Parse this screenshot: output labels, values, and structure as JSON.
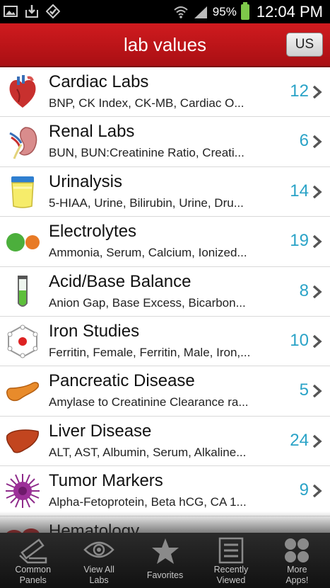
{
  "status_bar": {
    "battery_percent": "95%",
    "time": "12:04 PM",
    "icons": [
      "gallery-icon",
      "download-icon",
      "check-badge-icon",
      "wifi-icon",
      "signal-icon",
      "battery-icon"
    ]
  },
  "header": {
    "title": "lab values",
    "unit_button": "US"
  },
  "list": {
    "items": [
      {
        "title": "Cardiac Labs",
        "subtitle": "BNP, CK Index, CK-MB, Cardiac O...",
        "count": "12",
        "icon": "heart-icon"
      },
      {
        "title": "Renal Labs",
        "subtitle": "BUN, BUN:Creatinine Ratio, Creati...",
        "count": "6",
        "icon": "kidney-icon"
      },
      {
        "title": "Urinalysis",
        "subtitle": "5-HIAA, Urine, Bilirubin, Urine, Dru...",
        "count": "14",
        "icon": "urine-cup-icon"
      },
      {
        "title": "Electrolytes",
        "subtitle": "Ammonia, Serum, Calcium, Ionized...",
        "count": "19",
        "icon": "electrolytes-icon"
      },
      {
        "title": "Acid/Base Balance",
        "subtitle": "Anion Gap, Base Excess, Bicarbon...",
        "count": "8",
        "icon": "test-tube-icon"
      },
      {
        "title": "Iron Studies",
        "subtitle": "Ferritin, Female, Ferritin, Male, Iron,...",
        "count": "10",
        "icon": "molecule-icon"
      },
      {
        "title": "Pancreatic Disease",
        "subtitle": "Amylase to Creatinine Clearance ra...",
        "count": "5",
        "icon": "pancreas-icon"
      },
      {
        "title": "Liver Disease",
        "subtitle": "ALT, AST, Albumin, Serum, Alkaline...",
        "count": "24",
        "icon": "liver-icon"
      },
      {
        "title": "Tumor Markers",
        "subtitle": "Alpha-Fetoprotein, Beta hCG, CA 1...",
        "count": "9",
        "icon": "tumor-cell-icon"
      },
      {
        "title": "Hematology",
        "subtitle": "",
        "count": "",
        "icon": "blood-cells-icon"
      }
    ]
  },
  "tab_bar": {
    "tabs": [
      {
        "label_line1": "Common",
        "label_line2": "Panels",
        "icon": "test-tube-rack-icon"
      },
      {
        "label_line1": "View All",
        "label_line2": "Labs",
        "icon": "eye-icon"
      },
      {
        "label_line1": "Favorites",
        "label_line2": "",
        "icon": "star-icon"
      },
      {
        "label_line1": "Recently",
        "label_line2": "Viewed",
        "icon": "list-icon"
      },
      {
        "label_line1": "More",
        "label_line2": "Apps!",
        "icon": "four-dots-icon"
      }
    ]
  },
  "colors": {
    "header_red": "#c0161a",
    "count_blue": "#2aa3c7",
    "tab_bar": "#1c1c1c"
  }
}
